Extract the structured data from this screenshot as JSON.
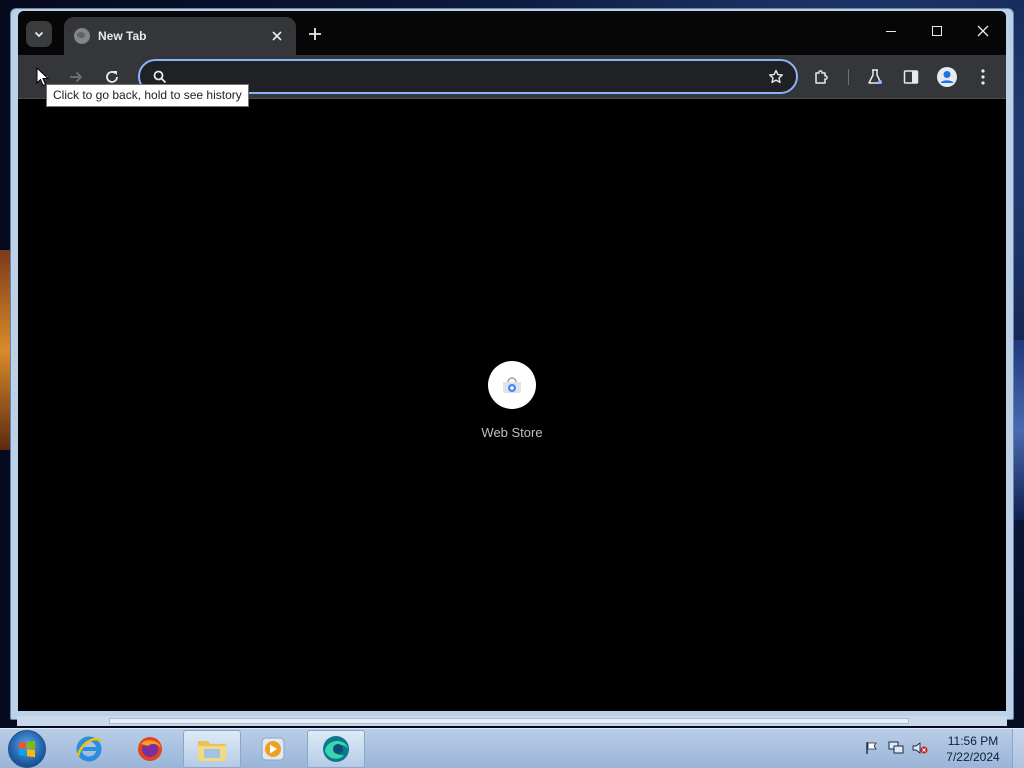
{
  "browser": {
    "tab": {
      "title": "New Tab"
    },
    "omnibox": {
      "value": "",
      "placeholder": ""
    },
    "tooltip": "Click to go back, hold to see history",
    "accent_color": "#8ab4f8"
  },
  "content": {
    "shortcuts": [
      {
        "label": "Web Store",
        "icon": "web-store-icon"
      }
    ]
  },
  "taskbar": {
    "apps": [
      "internet-explorer-icon",
      "firefox-icon",
      "file-explorer-icon",
      "media-player-icon",
      "edge-icon"
    ],
    "clock": {
      "time": "11:56 PM",
      "date": "7/22/2024"
    }
  }
}
